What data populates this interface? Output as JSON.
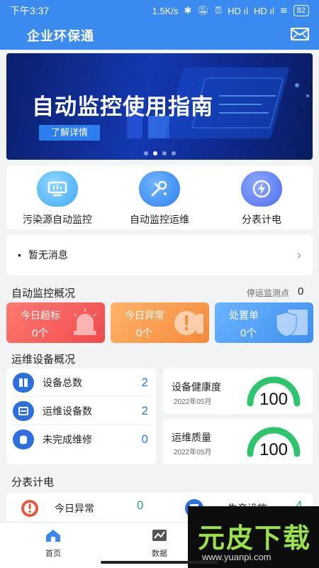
{
  "status_bar": {
    "time": "下午3:37",
    "speed": "1.5K/s",
    "signal_1": "HD ıl",
    "signal_2": "HD ıl",
    "battery": "82"
  },
  "header": {
    "title": "企业环保通",
    "mail_icon": "mail-icon"
  },
  "banner": {
    "title": "自动监控使用指南",
    "button": "了解详情",
    "dot_count": 4,
    "active_dot": 1
  },
  "quick_menu": [
    {
      "label": "污染源自动监控",
      "icon": "monitor-icon",
      "color": "#3fa9f5"
    },
    {
      "label": "自动监控运维",
      "icon": "tools-icon",
      "color": "#2f7ff0"
    },
    {
      "label": "分表计电",
      "icon": "power-icon",
      "color": "#4a6ef0"
    }
  ],
  "notice": {
    "bullet": "•",
    "text": "暂无消息",
    "chevron": "›"
  },
  "monitor_overview": {
    "title": "自动监控概况",
    "stopped_label": "停运监测点",
    "stopped_count": "0",
    "tiles": [
      {
        "label": "今日超标",
        "value": "0个",
        "color": "#f25a5a",
        "icon": "alarm-light-icon"
      },
      {
        "label": "今日异常",
        "value": "0个",
        "color": "#f59a46",
        "icon": "warning-icon"
      },
      {
        "label": "处置单",
        "value": "0个",
        "color": "#4a9af5",
        "icon": "shield-icon"
      }
    ]
  },
  "equipment_overview": {
    "title": "运维设备概况",
    "rows": [
      {
        "label": "设备总数",
        "value": "2",
        "icon": "device-icon"
      },
      {
        "label": "运维设备数",
        "value": "2",
        "icon": "maintenance-icon"
      },
      {
        "label": "未完成维修",
        "value": "0",
        "icon": "repair-icon"
      }
    ],
    "gauges": [
      {
        "label": "设备健康度",
        "date": "2022年05月",
        "value": "100",
        "fraction": 1.0
      },
      {
        "label": "运维质量",
        "date": "2022年05月",
        "value": "100",
        "fraction": 1.0
      }
    ]
  },
  "meter": {
    "title": "分表计电",
    "items": [
      {
        "label": "今日异常",
        "value": "0",
        "icon": "alert-circle-icon"
      },
      {
        "label": "生产设施",
        "value": "4",
        "icon": "factory-icon"
      }
    ]
  },
  "bottom_nav": [
    {
      "label": "首页",
      "icon": "home-icon",
      "active": true
    },
    {
      "label": "数据",
      "icon": "chart-icon",
      "active": false
    }
  ],
  "watermark": {
    "text": "元皮下载",
    "url": "www.yuanpi.com"
  },
  "colors": {
    "primary": "#3a8af0",
    "accent_blue": "#2b7be0",
    "accent_green": "#2aa87a"
  }
}
